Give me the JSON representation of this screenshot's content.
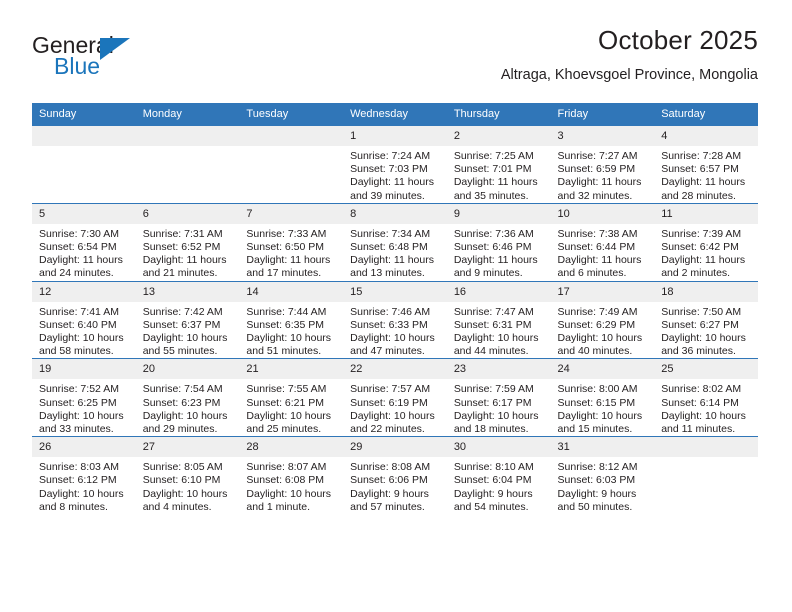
{
  "logo": {
    "word1": "General",
    "word2": "Blue",
    "triangle_color": "#1b75bb",
    "icon": "blue-triangle-icon"
  },
  "header": {
    "title": "October 2025",
    "subtitle": "Altraga, Khoevsgoel Province, Mongolia"
  },
  "theme": {
    "header_blue": "#3076b8",
    "daynum_band": "#efefef",
    "text": "#231f20",
    "logo_blue": "#1b75bb"
  },
  "weekdays": [
    "Sunday",
    "Monday",
    "Tuesday",
    "Wednesday",
    "Thursday",
    "Friday",
    "Saturday"
  ],
  "labels": {
    "sunrise": "Sunrise:",
    "sunset": "Sunset:",
    "daylight": "Daylight:"
  },
  "weeks": [
    [
      {
        "day": "",
        "blank": true
      },
      {
        "day": "",
        "blank": true
      },
      {
        "day": "",
        "blank": true
      },
      {
        "day": "1",
        "sunrise": "Sunrise: 7:24 AM",
        "sunset": "Sunset: 7:03 PM",
        "daylight1": "Daylight: 11 hours",
        "daylight2": "and 39 minutes."
      },
      {
        "day": "2",
        "sunrise": "Sunrise: 7:25 AM",
        "sunset": "Sunset: 7:01 PM",
        "daylight1": "Daylight: 11 hours",
        "daylight2": "and 35 minutes."
      },
      {
        "day": "3",
        "sunrise": "Sunrise: 7:27 AM",
        "sunset": "Sunset: 6:59 PM",
        "daylight1": "Daylight: 11 hours",
        "daylight2": "and 32 minutes."
      },
      {
        "day": "4",
        "sunrise": "Sunrise: 7:28 AM",
        "sunset": "Sunset: 6:57 PM",
        "daylight1": "Daylight: 11 hours",
        "daylight2": "and 28 minutes."
      }
    ],
    [
      {
        "day": "5",
        "sunrise": "Sunrise: 7:30 AM",
        "sunset": "Sunset: 6:54 PM",
        "daylight1": "Daylight: 11 hours",
        "daylight2": "and 24 minutes."
      },
      {
        "day": "6",
        "sunrise": "Sunrise: 7:31 AM",
        "sunset": "Sunset: 6:52 PM",
        "daylight1": "Daylight: 11 hours",
        "daylight2": "and 21 minutes."
      },
      {
        "day": "7",
        "sunrise": "Sunrise: 7:33 AM",
        "sunset": "Sunset: 6:50 PM",
        "daylight1": "Daylight: 11 hours",
        "daylight2": "and 17 minutes."
      },
      {
        "day": "8",
        "sunrise": "Sunrise: 7:34 AM",
        "sunset": "Sunset: 6:48 PM",
        "daylight1": "Daylight: 11 hours",
        "daylight2": "and 13 minutes."
      },
      {
        "day": "9",
        "sunrise": "Sunrise: 7:36 AM",
        "sunset": "Sunset: 6:46 PM",
        "daylight1": "Daylight: 11 hours",
        "daylight2": "and 9 minutes."
      },
      {
        "day": "10",
        "sunrise": "Sunrise: 7:38 AM",
        "sunset": "Sunset: 6:44 PM",
        "daylight1": "Daylight: 11 hours",
        "daylight2": "and 6 minutes."
      },
      {
        "day": "11",
        "sunrise": "Sunrise: 7:39 AM",
        "sunset": "Sunset: 6:42 PM",
        "daylight1": "Daylight: 11 hours",
        "daylight2": "and 2 minutes."
      }
    ],
    [
      {
        "day": "12",
        "sunrise": "Sunrise: 7:41 AM",
        "sunset": "Sunset: 6:40 PM",
        "daylight1": "Daylight: 10 hours",
        "daylight2": "and 58 minutes."
      },
      {
        "day": "13",
        "sunrise": "Sunrise: 7:42 AM",
        "sunset": "Sunset: 6:37 PM",
        "daylight1": "Daylight: 10 hours",
        "daylight2": "and 55 minutes."
      },
      {
        "day": "14",
        "sunrise": "Sunrise: 7:44 AM",
        "sunset": "Sunset: 6:35 PM",
        "daylight1": "Daylight: 10 hours",
        "daylight2": "and 51 minutes."
      },
      {
        "day": "15",
        "sunrise": "Sunrise: 7:46 AM",
        "sunset": "Sunset: 6:33 PM",
        "daylight1": "Daylight: 10 hours",
        "daylight2": "and 47 minutes."
      },
      {
        "day": "16",
        "sunrise": "Sunrise: 7:47 AM",
        "sunset": "Sunset: 6:31 PM",
        "daylight1": "Daylight: 10 hours",
        "daylight2": "and 44 minutes."
      },
      {
        "day": "17",
        "sunrise": "Sunrise: 7:49 AM",
        "sunset": "Sunset: 6:29 PM",
        "daylight1": "Daylight: 10 hours",
        "daylight2": "and 40 minutes."
      },
      {
        "day": "18",
        "sunrise": "Sunrise: 7:50 AM",
        "sunset": "Sunset: 6:27 PM",
        "daylight1": "Daylight: 10 hours",
        "daylight2": "and 36 minutes."
      }
    ],
    [
      {
        "day": "19",
        "sunrise": "Sunrise: 7:52 AM",
        "sunset": "Sunset: 6:25 PM",
        "daylight1": "Daylight: 10 hours",
        "daylight2": "and 33 minutes."
      },
      {
        "day": "20",
        "sunrise": "Sunrise: 7:54 AM",
        "sunset": "Sunset: 6:23 PM",
        "daylight1": "Daylight: 10 hours",
        "daylight2": "and 29 minutes."
      },
      {
        "day": "21",
        "sunrise": "Sunrise: 7:55 AM",
        "sunset": "Sunset: 6:21 PM",
        "daylight1": "Daylight: 10 hours",
        "daylight2": "and 25 minutes."
      },
      {
        "day": "22",
        "sunrise": "Sunrise: 7:57 AM",
        "sunset": "Sunset: 6:19 PM",
        "daylight1": "Daylight: 10 hours",
        "daylight2": "and 22 minutes."
      },
      {
        "day": "23",
        "sunrise": "Sunrise: 7:59 AM",
        "sunset": "Sunset: 6:17 PM",
        "daylight1": "Daylight: 10 hours",
        "daylight2": "and 18 minutes."
      },
      {
        "day": "24",
        "sunrise": "Sunrise: 8:00 AM",
        "sunset": "Sunset: 6:15 PM",
        "daylight1": "Daylight: 10 hours",
        "daylight2": "and 15 minutes."
      },
      {
        "day": "25",
        "sunrise": "Sunrise: 8:02 AM",
        "sunset": "Sunset: 6:14 PM",
        "daylight1": "Daylight: 10 hours",
        "daylight2": "and 11 minutes."
      }
    ],
    [
      {
        "day": "26",
        "sunrise": "Sunrise: 8:03 AM",
        "sunset": "Sunset: 6:12 PM",
        "daylight1": "Daylight: 10 hours",
        "daylight2": "and 8 minutes."
      },
      {
        "day": "27",
        "sunrise": "Sunrise: 8:05 AM",
        "sunset": "Sunset: 6:10 PM",
        "daylight1": "Daylight: 10 hours",
        "daylight2": "and 4 minutes."
      },
      {
        "day": "28",
        "sunrise": "Sunrise: 8:07 AM",
        "sunset": "Sunset: 6:08 PM",
        "daylight1": "Daylight: 10 hours",
        "daylight2": "and 1 minute."
      },
      {
        "day": "29",
        "sunrise": "Sunrise: 8:08 AM",
        "sunset": "Sunset: 6:06 PM",
        "daylight1": "Daylight: 9 hours",
        "daylight2": "and 57 minutes."
      },
      {
        "day": "30",
        "sunrise": "Sunrise: 8:10 AM",
        "sunset": "Sunset: 6:04 PM",
        "daylight1": "Daylight: 9 hours",
        "daylight2": "and 54 minutes."
      },
      {
        "day": "31",
        "sunrise": "Sunrise: 8:12 AM",
        "sunset": "Sunset: 6:03 PM",
        "daylight1": "Daylight: 9 hours",
        "daylight2": "and 50 minutes."
      },
      {
        "day": "",
        "blank": true
      }
    ]
  ]
}
